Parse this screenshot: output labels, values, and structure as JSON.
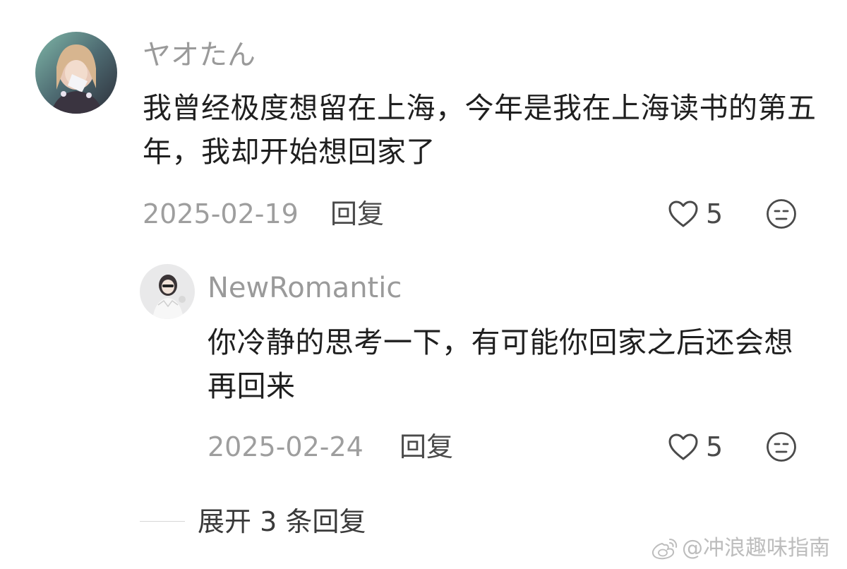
{
  "comment": {
    "username": "ヤオたん",
    "text": "我曾经极度想留在上海，今年是我在上海读书的第五年，我却开始想回家了",
    "date": "2025-02-19",
    "reply_label": "回复",
    "like_count": "5"
  },
  "reply": {
    "username": "NewRomantic",
    "text": "你冷静的思考一下，有可能你回家之后还会想再回来",
    "date": "2025-02-24",
    "reply_label": "回复",
    "like_count": "5"
  },
  "expand_replies": {
    "label": "展开 3 条回复"
  },
  "watermark": {
    "text": "@冲浪趣味指南",
    "icon": "weibo-icon"
  },
  "icons": {
    "like": "heart-outline-icon",
    "dislike": "neutral-face-icon"
  },
  "colors": {
    "username": "#9a9a9a",
    "body_text": "#1f1f1f",
    "meta": "#9e9e9e",
    "icon_stroke": "#4a4a4a"
  }
}
